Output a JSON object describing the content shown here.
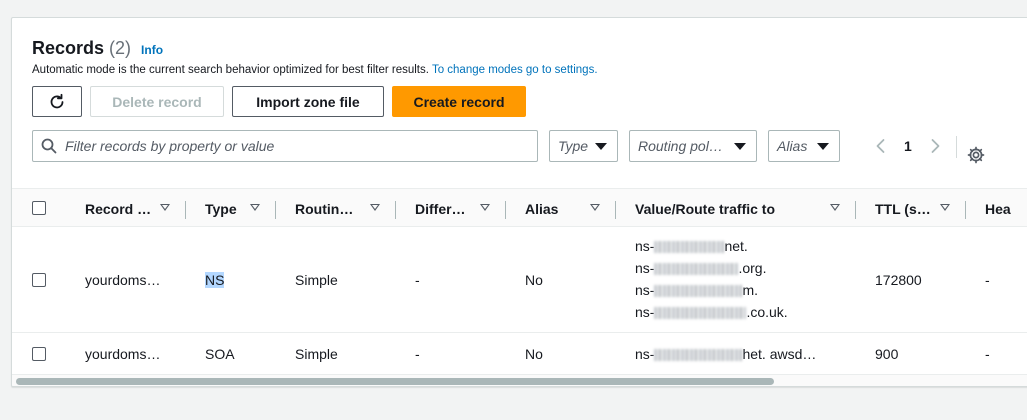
{
  "header": {
    "title": "Records",
    "count": "(2)",
    "info": "Info",
    "description": "Automatic mode is the current search behavior optimized for best filter results.",
    "description_link": "To change modes go to settings."
  },
  "toolbar": {
    "refresh_icon": "refresh-icon",
    "delete_label": "Delete record",
    "import_label": "Import zone file",
    "create_label": "Create record"
  },
  "filters": {
    "search_placeholder": "Filter records by property or value",
    "type_label": "Type",
    "routing_label": "Routing pol…",
    "alias_label": "Alias"
  },
  "pagination": {
    "current_page": "1"
  },
  "table": {
    "columns": [
      "Record …",
      "Type",
      "Routin…",
      "Differ…",
      "Alias",
      "Value/Route traffic to",
      "TTL (s…",
      "Hea"
    ],
    "rows": [
      {
        "name": "yourdoms…",
        "type": "NS",
        "routing": "Simple",
        "differentiator": "-",
        "alias": "No",
        "values": [
          {
            "prefix": "ns-",
            "suffix": "net."
          },
          {
            "prefix": "ns-",
            "suffix": ".org."
          },
          {
            "prefix": "ns-",
            "suffix": "m."
          },
          {
            "prefix": "ns-",
            "suffix": ".co.uk."
          }
        ],
        "ttl": "172800",
        "health": "-"
      },
      {
        "name": "yourdoms…",
        "type": "SOA",
        "routing": "Simple",
        "differentiator": "-",
        "alias": "No",
        "values": [
          {
            "prefix": "ns-",
            "suffix": "het. awsd…"
          }
        ],
        "ttl": "900",
        "health": "-"
      }
    ]
  },
  "colors": {
    "primary": "#ff9900",
    "link": "#0073bb",
    "border": "#aab7b8",
    "selection": "#b3d7ff"
  }
}
